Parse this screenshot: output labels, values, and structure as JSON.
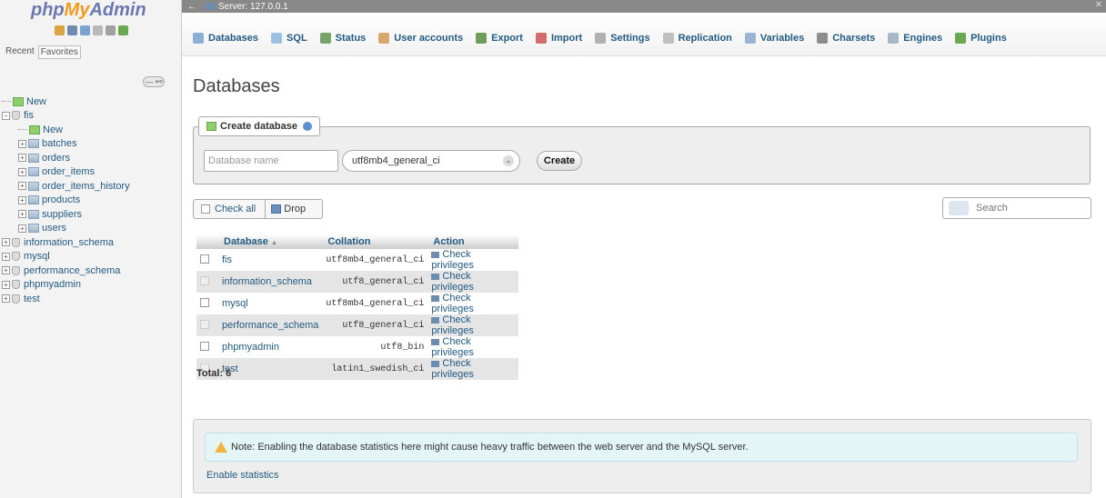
{
  "app": {
    "logo": {
      "php": "php",
      "my": "My",
      "admin": "Admin"
    }
  },
  "sidebar": {
    "tabs": [
      "Recent",
      "Favorites"
    ],
    "tree": [
      {
        "label": "New",
        "level": 0,
        "kind": "new"
      },
      {
        "label": "fis",
        "level": 0,
        "kind": "db",
        "expanded": true
      },
      {
        "label": "New",
        "level": 1,
        "kind": "new"
      },
      {
        "label": "batches",
        "level": 1,
        "kind": "table"
      },
      {
        "label": "orders",
        "level": 1,
        "kind": "table"
      },
      {
        "label": "order_items",
        "level": 1,
        "kind": "table"
      },
      {
        "label": "order_items_history",
        "level": 1,
        "kind": "table"
      },
      {
        "label": "products",
        "level": 1,
        "kind": "table"
      },
      {
        "label": "suppliers",
        "level": 1,
        "kind": "table"
      },
      {
        "label": "users",
        "level": 1,
        "kind": "table"
      },
      {
        "label": "information_schema",
        "level": 0,
        "kind": "db"
      },
      {
        "label": "mysql",
        "level": 0,
        "kind": "db"
      },
      {
        "label": "performance_schema",
        "level": 0,
        "kind": "db"
      },
      {
        "label": "phpmyadmin",
        "level": 0,
        "kind": "db"
      },
      {
        "label": "test",
        "level": 0,
        "kind": "db"
      }
    ]
  },
  "topbar": {
    "server": "Server: 127.0.0.1"
  },
  "tabs": [
    {
      "label": "Databases",
      "icon": "database-icon",
      "color": "#8ab0d8"
    },
    {
      "label": "SQL",
      "icon": "sql-icon",
      "color": "#9cc0e0"
    },
    {
      "label": "Status",
      "icon": "status-icon",
      "color": "#7aa36b"
    },
    {
      "label": "User accounts",
      "icon": "users-icon",
      "color": "#d6a86b"
    },
    {
      "label": "Export",
      "icon": "export-icon",
      "color": "#6f9e5b"
    },
    {
      "label": "Import",
      "icon": "import-icon",
      "color": "#d36d6d"
    },
    {
      "label": "Settings",
      "icon": "settings-icon",
      "color": "#b0b0b0"
    },
    {
      "label": "Replication",
      "icon": "replication-icon",
      "color": "#c0c0c0"
    },
    {
      "label": "Variables",
      "icon": "variables-icon",
      "color": "#9ab4d4"
    },
    {
      "label": "Charsets",
      "icon": "charsets-icon",
      "color": "#8d8d8d"
    },
    {
      "label": "Engines",
      "icon": "engines-icon",
      "color": "#a8b8c8"
    },
    {
      "label": "Plugins",
      "icon": "plugins-icon",
      "color": "#6aa84f"
    }
  ],
  "main": {
    "title": "Databases",
    "create": {
      "legend": "Create database",
      "name_placeholder": "Database name",
      "collation": "utf8mb4_general_ci",
      "button": "Create"
    },
    "toolbar": {
      "check_all": "Check all",
      "drop": "Drop"
    },
    "search_placeholder": "Search",
    "table": {
      "headers": [
        "Database",
        "Collation",
        "Action"
      ],
      "sort_indicator": "▲",
      "rows": [
        {
          "name": "fis",
          "collation": "utf8mb4_general_ci",
          "action": "Check privileges"
        },
        {
          "name": "information_schema",
          "collation": "utf8_general_ci",
          "action": "Check privileges"
        },
        {
          "name": "mysql",
          "collation": "utf8mb4_general_ci",
          "action": "Check privileges"
        },
        {
          "name": "performance_schema",
          "collation": "utf8_general_ci",
          "action": "Check privileges"
        },
        {
          "name": "phpmyadmin",
          "collation": "utf8_bin",
          "action": "Check privileges"
        },
        {
          "name": "test",
          "collation": "latin1_swedish_ci",
          "action": "Check privileges"
        }
      ]
    },
    "total": "Total: 6",
    "notice": "Note: Enabling the database statistics here might cause heavy traffic between the web server and the MySQL server.",
    "enable_stats": "Enable statistics"
  }
}
